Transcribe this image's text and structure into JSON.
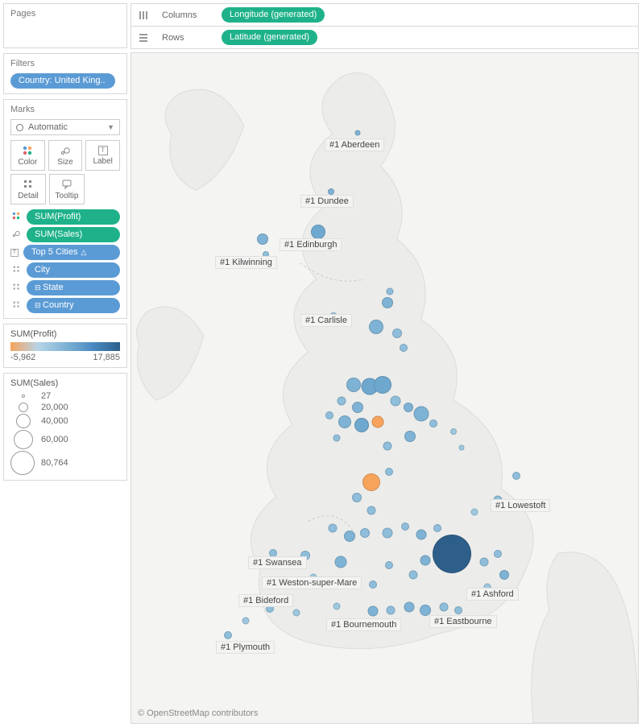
{
  "cards": {
    "pages_title": "Pages",
    "filters_title": "Filters",
    "marks_title": "Marks"
  },
  "filters": {
    "country_pill": "Country: United King.."
  },
  "marks": {
    "dropdown": "Automatic",
    "color": "Color",
    "size": "Size",
    "label": "Label",
    "detail": "Detail",
    "tooltip": "Tooltip"
  },
  "mark_fields": {
    "profit": "SUM(Profit)",
    "sales": "SUM(Sales)",
    "top5": "Top 5 Cities",
    "city": "City",
    "state": "State",
    "country": "Country"
  },
  "legends": {
    "profit_title": "SUM(Profit)",
    "profit_min": "-5,962",
    "profit_max": "17,885",
    "sales_title": "SUM(Sales)",
    "s1": "27",
    "s2": "20,000",
    "s3": "40,000",
    "s4": "60,000",
    "s5": "80,764"
  },
  "shelves": {
    "columns_label": "Columns",
    "rows_label": "Rows",
    "columns_pill": "Longitude (generated)",
    "rows_pill": "Latitude (generated)"
  },
  "map": {
    "attribution": "© OpenStreetMap contributors",
    "labels": {
      "aberdeen": "#1 Aberdeen",
      "dundee": "#1 Dundee",
      "edinburgh": "#1 Edinburgh",
      "kilwinning": "#1 Kilwinning",
      "carlisle": "#1 Carlisle",
      "lowestoft": "#1 Lowestoft",
      "swansea": "#1 Swansea",
      "weston": "#1 Weston-super-Mare",
      "bideford": "#1 Bideford",
      "bournemouth": "#1 Bournemouth",
      "ashford": "#1 Ashford",
      "eastbourne": "#1 Eastbourne",
      "plymouth": "#1 Plymouth"
    }
  },
  "chart_data": {
    "type": "scatter",
    "title": "",
    "xlabel": "Longitude (generated)",
    "ylabel": "Latitude (generated)",
    "color_field": "SUM(Profit)",
    "color_range": [
      -5962,
      17885
    ],
    "size_field": "SUM(Sales)",
    "size_range": [
      27,
      80764
    ],
    "filter": "Country: United Kingdom",
    "labeled_points": [
      {
        "city": "Aberdeen",
        "rank_label": "#1"
      },
      {
        "city": "Dundee",
        "rank_label": "#1"
      },
      {
        "city": "Edinburgh",
        "rank_label": "#1"
      },
      {
        "city": "Kilwinning",
        "rank_label": "#1"
      },
      {
        "city": "Carlisle",
        "rank_label": "#1"
      },
      {
        "city": "Lowestoft",
        "rank_label": "#1"
      },
      {
        "city": "Swansea",
        "rank_label": "#1"
      },
      {
        "city": "Weston-super-Mare",
        "rank_label": "#1"
      },
      {
        "city": "Bideford",
        "rank_label": "#1"
      },
      {
        "city": "Bournemouth",
        "rank_label": "#1"
      },
      {
        "city": "Ashford",
        "rank_label": "#1"
      },
      {
        "city": "Eastbourne",
        "rank_label": "#1"
      },
      {
        "city": "Plymouth",
        "rank_label": "#1"
      }
    ],
    "notes": "Map of UK cities; circle size ~ SUM(Sales), color ~ SUM(Profit). Largest dark-blue circle ≈ London (highest profit & sales). Two orange circles (negative profit) in Midlands/North-West. Most points are mid-blue (moderate positive profit)."
  }
}
